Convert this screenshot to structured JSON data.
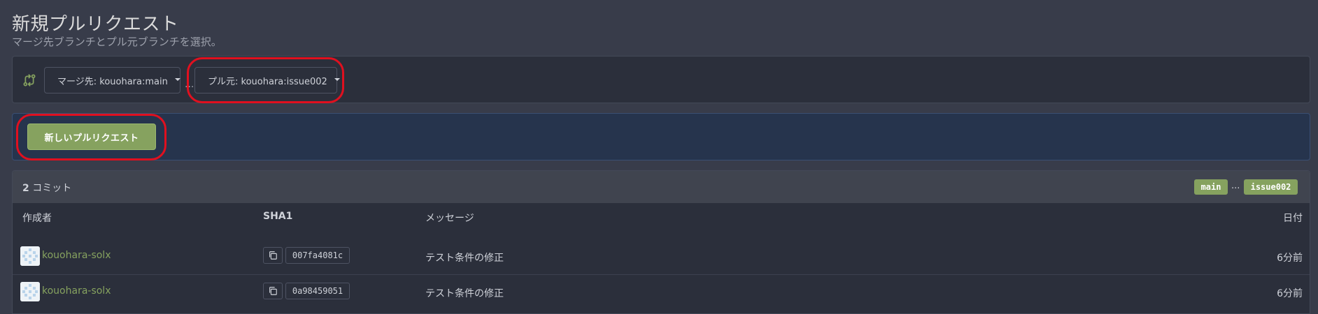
{
  "header": {
    "title": "新規プルリクエスト",
    "subtitle": "マージ先ブランチとプル元ブランチを選択。"
  },
  "branches": {
    "icon": "git-compare-icon",
    "base_label": "マージ先: kouohara:main",
    "separator": "...",
    "head_label": "プル元: kouohara:issue002"
  },
  "new_pr": {
    "button_label": "新しいプルリクエスト"
  },
  "commits": {
    "count": "2",
    "count_suffix": "コミット",
    "base_branch": "main",
    "dots": "...",
    "head_branch": "issue002",
    "columns": {
      "author": "作成者",
      "sha": "SHA1",
      "message": "メッセージ",
      "date": "日付"
    },
    "rows": [
      {
        "author": "kouohara-solx",
        "sha": "007fa4081c",
        "message": "テスト条件の修正",
        "date": "6分前"
      },
      {
        "author": "kouohara-solx",
        "sha": "0a98459051",
        "message": "テスト条件の修正",
        "date": "6分前"
      }
    ]
  },
  "colors": {
    "background": "#383c4a",
    "panel": "#2b2f3b",
    "accent_green": "#86a25f",
    "highlight_panel": "#26344d",
    "annotation_red": "#e0101f"
  }
}
